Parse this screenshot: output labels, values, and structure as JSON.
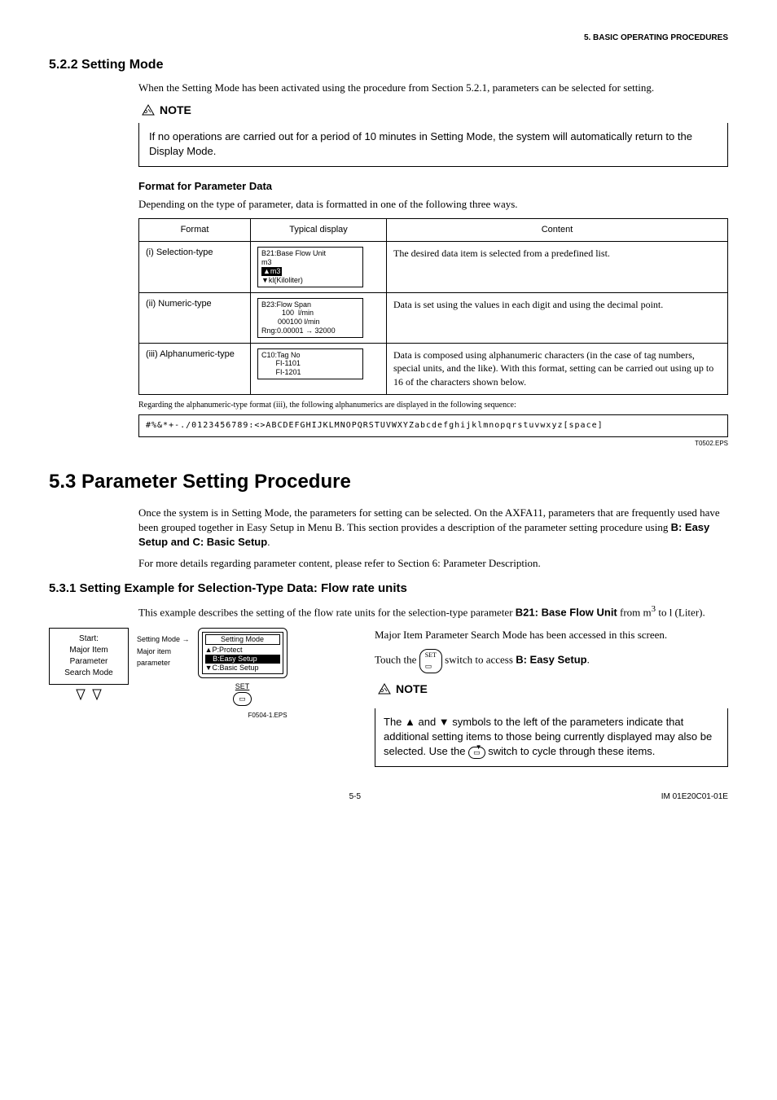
{
  "header": {
    "chapter": "5.  BASIC OPERATING PROCEDURES"
  },
  "s522": {
    "title": "5.2.2    Setting Mode",
    "intro": "When the Setting Mode has been activated using the procedure from Section 5.2.1, parameters can be selected for setting.",
    "note_label": "NOTE",
    "note_text": "If no operations are carried out for a period of 10 minutes in Setting Mode, the system will automatically return to the Display Mode."
  },
  "fpd": {
    "title": "Format for Parameter Data",
    "intro": "Depending on the type of parameter, data is formatted in one of the following three ways.",
    "headers": {
      "format": "Format",
      "display": "Typical display",
      "content": "Content"
    },
    "rows": [
      {
        "format": "(i) Selection-type",
        "disp": {
          "l1": "B21:Base Flow Unit",
          "l2": "m3",
          "l3_hl": "▲m3",
          "l4": "▼kl(Kiloliter)"
        },
        "content": "The desired data item is selected from a predefined list."
      },
      {
        "format": "(ii) Numeric-type",
        "disp": {
          "l1": "B23:Flow Span",
          "l2": "          100  l/min",
          "l3": "        000100 l/min",
          "l4": "Rng:0.00001 → 32000"
        },
        "content": "Data is set using the values in each digit and using the decimal point."
      },
      {
        "format": "(iii) Alphanumeric-type",
        "disp": {
          "l1": "C10:Tag No",
          "l2": "       FI-1101",
          "l3": "       FI-1201"
        },
        "content": "Data is composed using alphanumeric characters (in the case of tag numbers, special units, and the like). With this format, setting can be carried out using up to 16 of the characters shown below."
      }
    ],
    "seq_note": "Regarding the alphanumeric-type format (iii), the following alphanumerics are displayed in the following sequence:",
    "seq_box": "#%&*+-./0123456789:<>ABCDEFGHIJKLMNOPQRSTUVWXYZabcdefghijklmnopqrstuvwxyz[space]",
    "eps": "T0502.EPS"
  },
  "s53": {
    "title": "5.3   Parameter Setting Procedure",
    "p1_a": "Once the system is in Setting Mode, the parameters for setting can be selected. On the AXFA11, parameters that are frequently used have been grouped together in Easy Setup in Menu B. This section provides a description of the parameter setting procedure using ",
    "p1_b": "B: Easy Setup and C: Basic Setup",
    "p1_c": ".",
    "p2": "For more details regarding parameter content, please refer to Section 6: Parameter Description."
  },
  "s531": {
    "title": "5.3.1    Setting Example for Selection-Type Data: Flow rate units",
    "intro_a": "This example describes the setting of the flow rate units for the selection-type parameter ",
    "intro_b": "B21: Base Flow Unit",
    "intro_c": " from m",
    "intro_d": " to l (Liter).",
    "flow": {
      "start_l1": "Start:",
      "start_l2": "Major Item",
      "start_l3": "Parameter",
      "start_l4": "Search Mode",
      "arrow1": "Setting Mode",
      "arrow2": "Major item",
      "arrow3": "parameter",
      "screen_title": "Setting Mode",
      "screen_l1": "▲P:Protect",
      "screen_hl": "   B:Easy Setup",
      "screen_l3": "▼C:Basic Setup",
      "set": "SET",
      "eps": "F0504-1.EPS"
    },
    "right": {
      "p1": "Major Item Parameter Search Mode has been accessed in this screen.",
      "p2_a": "Touch the ",
      "p2_b": " switch to access ",
      "p2_c": "B: Easy Setup",
      "p2_d": ".",
      "note_label": "NOTE",
      "note_text_a": "The ▲ and ▼ symbols to the left of the parameters indicate that additional setting items to those being currently displayed may also be selected. Use the ",
      "note_text_b": " switch to cycle through these items."
    }
  },
  "footer": {
    "page": "5-5",
    "doc": "IM 01E20C01-01E"
  }
}
